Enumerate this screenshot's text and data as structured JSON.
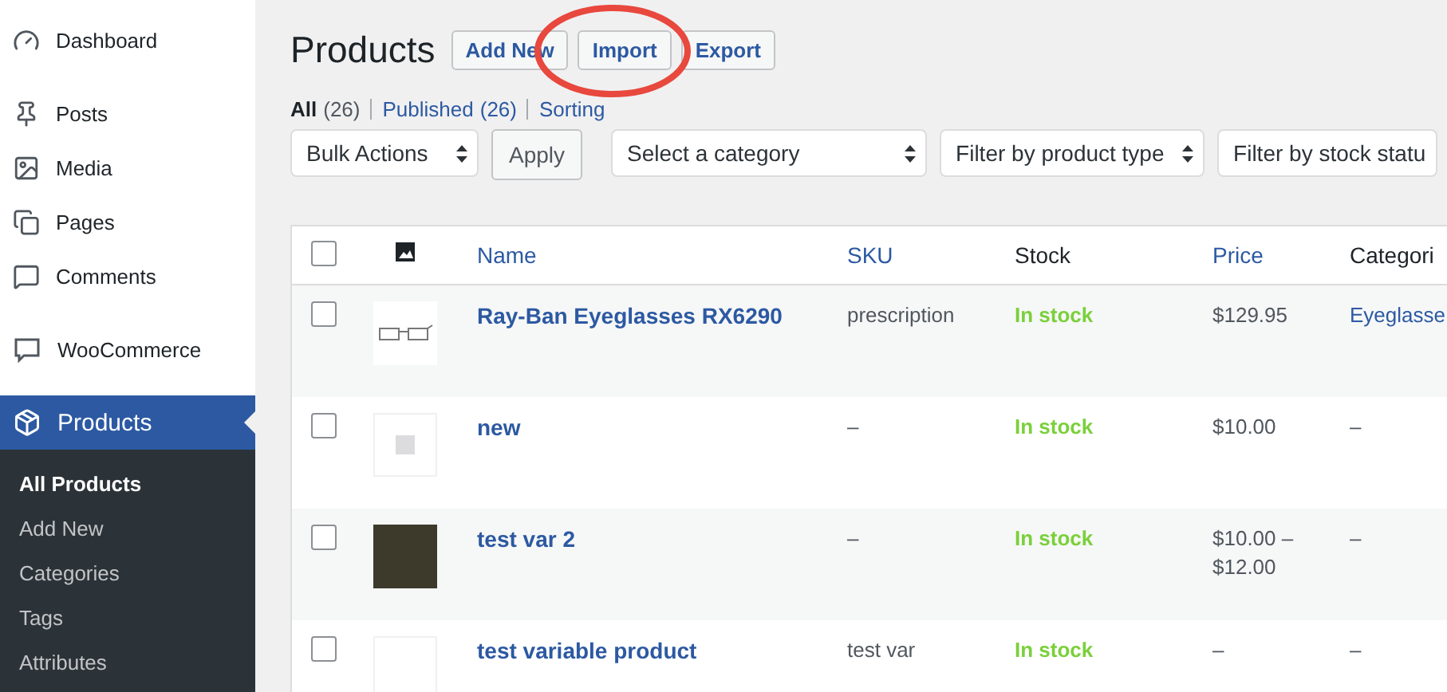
{
  "sidebar": {
    "items": [
      {
        "label": "Dashboard",
        "selected": false
      },
      {
        "label": "Posts",
        "selected": false
      },
      {
        "label": "Media",
        "selected": false
      },
      {
        "label": "Pages",
        "selected": false
      },
      {
        "label": "Comments",
        "selected": false
      },
      {
        "label": "WooCommerce",
        "selected": false
      },
      {
        "label": "Products",
        "selected": true
      }
    ],
    "submenu": [
      {
        "label": "All Products",
        "selected": true
      },
      {
        "label": "Add New",
        "selected": false
      },
      {
        "label": "Categories",
        "selected": false
      },
      {
        "label": "Tags",
        "selected": false
      },
      {
        "label": "Attributes",
        "selected": false
      }
    ]
  },
  "header": {
    "title": "Products",
    "buttons": [
      "Add New",
      "Import",
      "Export"
    ],
    "annotation": {
      "kind": "ellipse"
    }
  },
  "views": [
    {
      "label": "All",
      "count": "(26)",
      "selected": true
    },
    {
      "label": "Published",
      "count": "(26)",
      "selected": false
    },
    {
      "label": "Sorting",
      "selected": false
    }
  ],
  "filters": {
    "bulk": "Bulk Actions",
    "apply": "Apply",
    "selects": [
      "Select a category",
      "Filter by product type",
      "Filter by stock statu"
    ]
  },
  "table": {
    "columns": [
      {
        "label": "Name",
        "sortable": true
      },
      {
        "label": "SKU",
        "sortable": true
      },
      {
        "label": "Stock",
        "sortable": false
      },
      {
        "label": "Price",
        "sortable": true
      },
      {
        "label": "Categori",
        "sortable": false
      }
    ],
    "header_checked": false,
    "rows": [
      {
        "kind": "glasses",
        "checked": false,
        "name": "Ray-Ban Eyeglasses RX6290",
        "sku": "prescription",
        "stock": "In stock",
        "price": "$129.95",
        "categories": "Eyeglasse",
        "category_link": true
      },
      {
        "kind": "placeholder",
        "checked": false,
        "name": "new",
        "sku": "–",
        "stock": "In stock",
        "price": "$10.00",
        "categories": "–",
        "category_link": false
      },
      {
        "kind": "photo",
        "checked": false,
        "name": "test var 2",
        "sku": "–",
        "stock": "In stock",
        "price": "$10.00 – $12.00",
        "categories": "–",
        "category_link": false
      },
      {
        "kind": "blank",
        "checked": false,
        "name": "test variable product",
        "sku": "test var",
        "stock": "In stock",
        "price": "–",
        "categories": "–",
        "category_link": false
      }
    ]
  }
}
